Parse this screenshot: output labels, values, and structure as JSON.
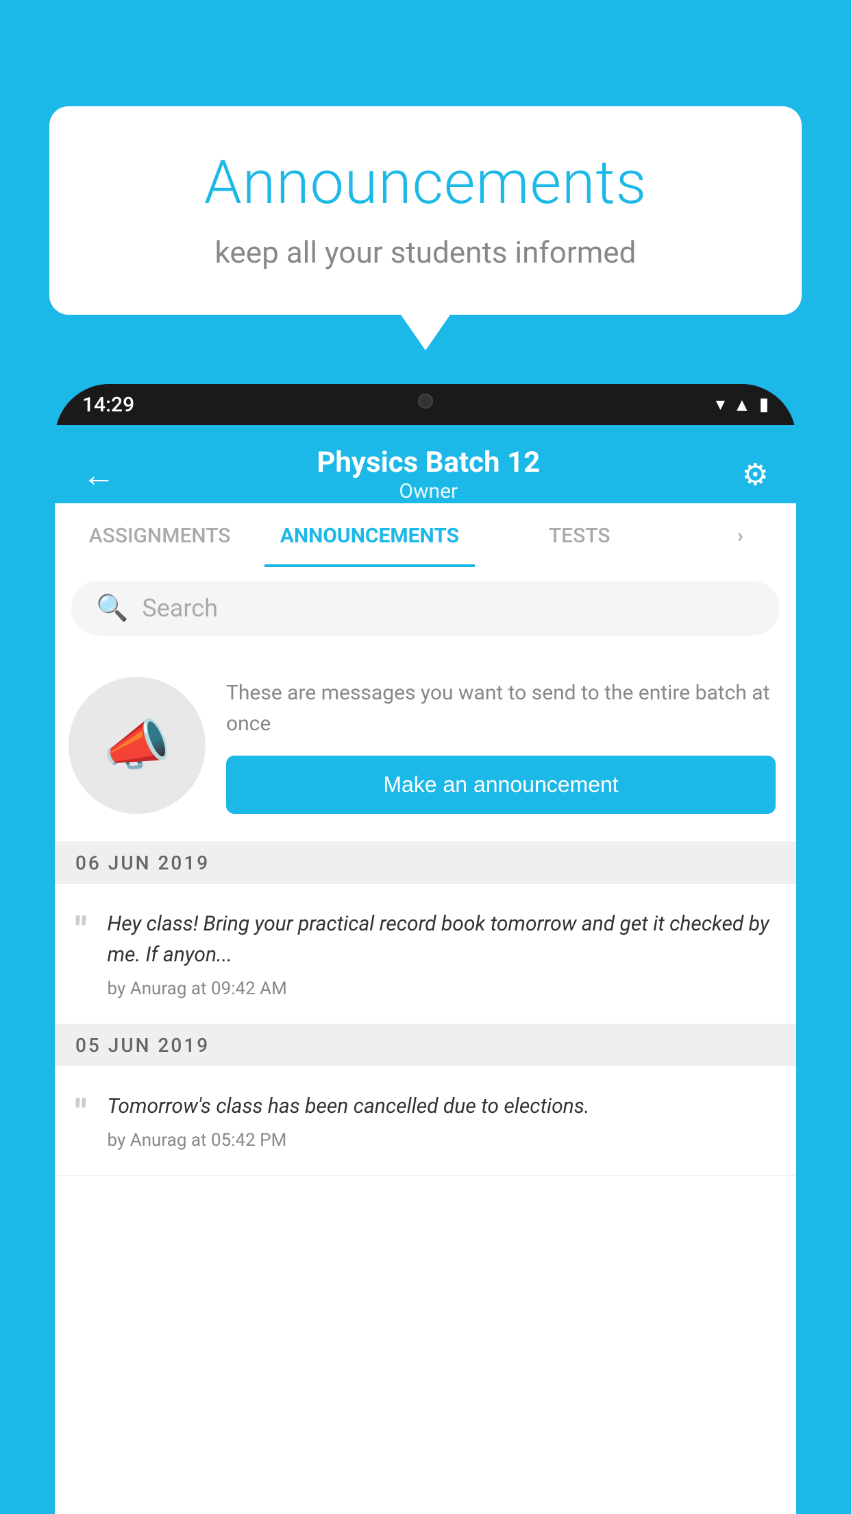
{
  "background_color": "#1cb8e8",
  "speech_bubble": {
    "title": "Announcements",
    "subtitle": "keep all your students informed"
  },
  "phone": {
    "status_bar": {
      "time": "14:29"
    },
    "header": {
      "back_label": "←",
      "title": "Physics Batch 12",
      "subtitle": "Owner",
      "gear_icon": "⚙"
    },
    "tabs": [
      {
        "label": "ASSIGNMENTS",
        "active": false
      },
      {
        "label": "ANNOUNCEMENTS",
        "active": true
      },
      {
        "label": "TESTS",
        "active": false
      },
      {
        "label": "»",
        "active": false
      }
    ],
    "search": {
      "placeholder": "Search"
    },
    "cta": {
      "description": "These are messages you want to send to the entire batch at once",
      "button_label": "Make an announcement"
    },
    "date_sections": [
      {
        "date": "06  JUN  2019",
        "announcements": [
          {
            "text": "Hey class! Bring your practical record book tomorrow and get it checked by me. If anyon...",
            "meta": "by Anurag at 09:42 AM"
          }
        ]
      },
      {
        "date": "05  JUN  2019",
        "announcements": [
          {
            "text": "Tomorrow's class has been cancelled due to elections.",
            "meta": "by Anurag at 05:42 PM"
          }
        ]
      }
    ]
  }
}
